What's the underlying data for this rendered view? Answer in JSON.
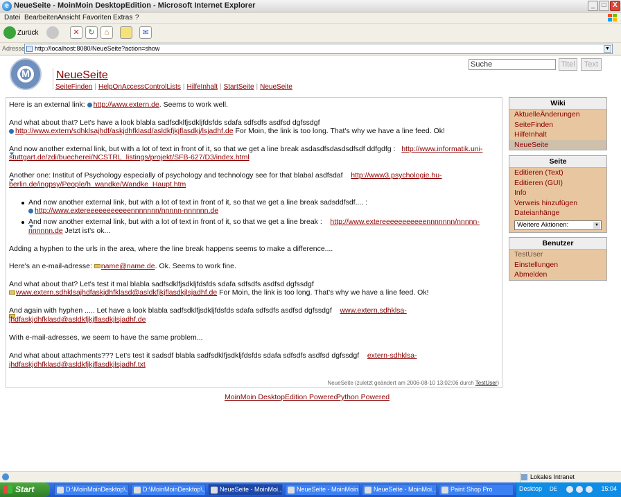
{
  "window": {
    "title": "NeueSeite - MoinMoin DesktopEdition - Microsoft Internet Explorer",
    "controls": {
      "minimize": "_",
      "maximize": "□",
      "close": "X"
    }
  },
  "menu": [
    "Datei",
    "Bearbeiten",
    "Ansicht",
    "Favoriten",
    "Extras",
    "?"
  ],
  "toolbar": {
    "back_label": "Zurück"
  },
  "address": {
    "label": "Adresse",
    "url": "http://localhost:8080/NeueSeite?action=show"
  },
  "header": {
    "page_title": "NeueSeite",
    "nav": [
      "SeiteFinden",
      "HelpOnAccessControlLists",
      "HilfeInhalt",
      "StartSeite",
      "NeueSeite"
    ],
    "search_value": "Suche",
    "title_button": "Titel",
    "text_button": "Text"
  },
  "content": {
    "p1": {
      "pre": "Here is an external link: ",
      "link": "http://www.extern.de",
      "post": ". Seems to work well."
    },
    "p2a": "And what about that? Let's have a look blabla sadfsdklfjsdkljfdsfds sdafa sdfsdfs asdfsd dgfssdgf",
    "p2b": {
      "link": "http://www.extern/sdhklsajhdf/askjdhfklasd/asldkfjkjflasdkj/lsjadhf.de",
      "post": " For Moin, the link is too long. That's why we have a line feed. Ok!"
    },
    "p3a": {
      "pre": "And now another external link, but with a lot of text in front of it, so that we get a line break asdasdfsdasdsdfsdf  ddfgdfg :",
      "link": "http://www.informatik.uni-"
    },
    "p3b": "stuttgart.de/zdi/buecherei/NCSTRL_listings/projekt/SFB-627/D3/index.html",
    "p4a": {
      "pre": "Another one: Institut of Psychology especially of psychology and technology see for that blabal asdfsdaf",
      "link": "http://www3.psychologie.hu-"
    },
    "p4b": "berlin.de/ingpsy/People/h_wandke/Wandke_Haupt.htm",
    "b1a": "And now another external link, but with a lot of text in front of it, so that we get a line break sadsddfsdf.... :",
    "b1b": "http://www.extereeeeeeeeeeennnnnnn/nnnnn-nnnnnn.de",
    "b2a": {
      "pre": "And now another external link, but with a lot of text in front of it, so that we get a line break :",
      "link": "http://www.extereeeeeeeeeeennnnnnn/nnnnn-"
    },
    "b2b": {
      "link": "nnnnnn.de",
      "post": " Jetzt ist's ok..."
    },
    "p5": "Adding a hyphen to the urls in the area, where the line break happens seems to make a difference....",
    "p6": {
      "pre": "Here's an e-mail-adresse: ",
      "link": "name@name.de",
      "post": ". Ok. Seems to work fine."
    },
    "p7a": "And what about that? Let's test it mal blabla sadfsdklfjsdkljfdsfds sdafa sdfsdfs asdfsd dgfssdgf",
    "p7b": {
      "link": "www.extern.sdhklsajhdfaskjdhfklasd@asldkfjkjflasdkjlsjadhf.de",
      "post": " For Moin, the link is too long. That's why we have a line feed. Ok!"
    },
    "p8a": {
      "pre": "And again with hyphen ..... Let have a look blabla sadfsdklfjsdkljfdsfds sdafa sdfsdfs asdfsd dgfssdgf",
      "link": "www.extern.sdhklsa-"
    },
    "p8b": "jhdfaskjdhfklasd@asldkfjkjflasdkjlsjadhf.de",
    "p9": "With e-mail-adresses, we seem to have the same problem...",
    "p10a": {
      "pre": "And what about attachments??? Let's test it sadsdf blabla sadfsdklfjsdkljfdsfds sdafa sdfsdfs asdfsd dgfssdgf",
      "link": "extern-sdhklsa-"
    },
    "p10b": "jhdfaskjdhfklasd@asldkfjkjflasdkjlsjadhf.txt",
    "meta": {
      "pre": "NeueSeite  (zuletzt geändert am 2006-08-10 13:02:06 durch ",
      "user": "TestUser",
      "post": ")"
    }
  },
  "powered": {
    "moin": "MoinMoin DesktopEdition Powered",
    "python": "Python Powered"
  },
  "sidebar": {
    "wiki": {
      "title": "Wiki",
      "items": [
        "AktuelleÄnderungen",
        "SeiteFinden",
        "HilfeInhalt",
        "NeueSeite"
      ]
    },
    "seite": {
      "title": "Seite",
      "items": [
        "Editieren (Text)",
        "Editieren (GUI)",
        "Info",
        "Verweis hinzufügen",
        "Dateianhänge"
      ],
      "actions_select": "Weitere Aktionen:"
    },
    "benutzer": {
      "title": "Benutzer",
      "items": [
        "TestUser",
        "Einstellungen",
        "Abmelden"
      ]
    }
  },
  "status": {
    "zone": "Lokales Intranet"
  },
  "taskbar": {
    "start": "Start",
    "tasks": [
      "D:\\MoinMoinDesktop\\...",
      "D:\\MoinMoinDesktop\\...",
      "NeueSeite - MoinMoi...",
      "NeueSeite - MoinMoin...",
      "NeueSeite - MoinMoi...",
      "Paint Shop Pro"
    ],
    "desktop": "Desktop",
    "lang": "DE",
    "clock": "15:04"
  }
}
